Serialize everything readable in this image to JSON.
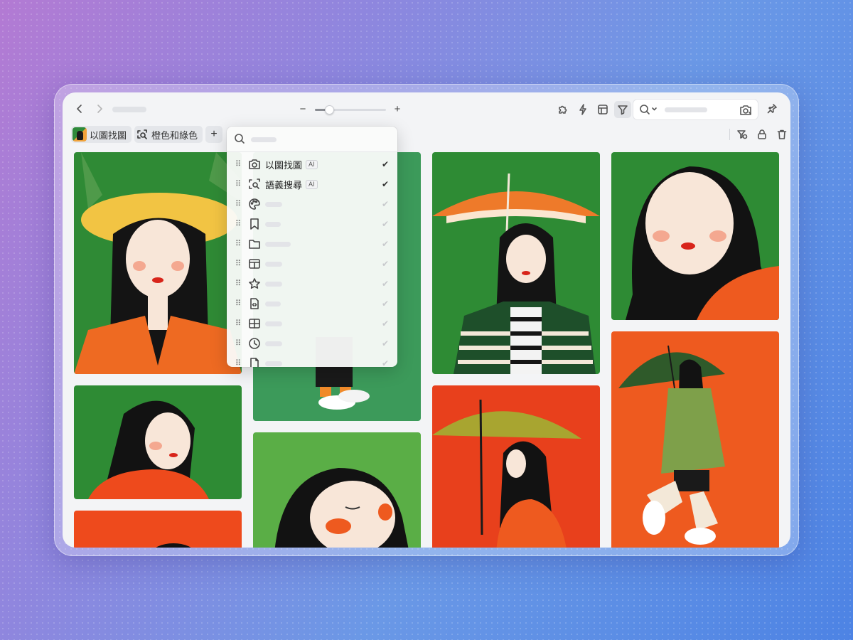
{
  "toolbar": {
    "back": "chevron-left-icon",
    "forward": "chevron-right-icon",
    "zoom": {
      "value": 0.2,
      "minus": "−",
      "plus": "+"
    },
    "tools": [
      "puzzle-icon",
      "lightning-icon",
      "layout-icon",
      "filter-icon"
    ],
    "active_tool": "filter-icon",
    "search_icon": "search-icon",
    "camera_icon": "image-search-icon",
    "pin_icon": "pin-icon"
  },
  "filters": {
    "chips": [
      {
        "label": "以圖找圖",
        "icon": "image-thumbnail"
      },
      {
        "label": "橙色和綠色",
        "icon": "semantic-search-icon"
      }
    ],
    "add_label": "+",
    "right_tools": [
      "filter-clear-icon",
      "lock-icon",
      "trash-icon"
    ]
  },
  "dropdown": {
    "items": [
      {
        "icon": "camera-icon",
        "label": "以圖找圖",
        "badge": "AI",
        "checked": true
      },
      {
        "icon": "semantic-search-icon",
        "label": "語義搜尋",
        "badge": "AI",
        "checked": true
      },
      {
        "icon": "palette-icon",
        "label": "",
        "checked": true
      },
      {
        "icon": "bookmark-icon",
        "label": "",
        "checked": true
      },
      {
        "icon": "folder-icon",
        "label": "",
        "checked": true
      },
      {
        "icon": "shape-icon",
        "label": "",
        "checked": true
      },
      {
        "icon": "star-icon",
        "label": "",
        "checked": true
      },
      {
        "icon": "code-file-icon",
        "label": "",
        "checked": true
      },
      {
        "icon": "dimensions-icon",
        "label": "",
        "checked": true
      },
      {
        "icon": "clock-icon",
        "label": "",
        "checked": true
      },
      {
        "icon": "file-icon",
        "label": "",
        "checked": true
      }
    ]
  },
  "colors": {
    "green": "#2e8b34",
    "orange": "#ee5a1f",
    "red": "#e8401c",
    "light_green": "#5aae46"
  }
}
